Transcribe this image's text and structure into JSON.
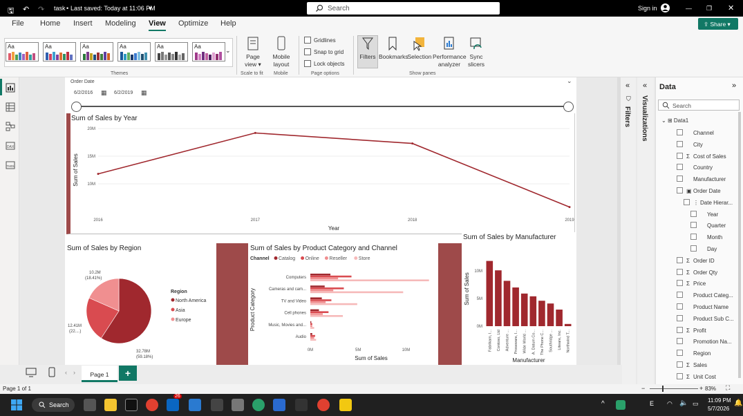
{
  "titlebar": {
    "file": "task",
    "saved": "Last saved: Today at 11:06 PM",
    "search": "Search",
    "signin": "Sign in",
    "share": "Share"
  },
  "menu": [
    "File",
    "Home",
    "Insert",
    "Modeling",
    "View",
    "Optimize",
    "Help"
  ],
  "ribbon": {
    "themes_label": "Themes",
    "page_view": "Page view",
    "scale_label": "Scale to fit",
    "mobile": "Mobile layout",
    "mobile_label": "Mobile",
    "gridlines": "Gridlines",
    "snap": "Snap to grid",
    "lock": "Lock objects",
    "page_options": "Page options",
    "filters": "Filters",
    "bookmarks": "Bookmarks",
    "selection": "Selection",
    "performance": "Performance analyzer",
    "sync": "Sync slicers",
    "show_panes": "Show panes",
    "theme_tag": "Aa"
  },
  "slicer": {
    "title": "Order Date",
    "start": "6/2/2016",
    "end": "6/2/2019"
  },
  "line_chart": {
    "title": "Sum of Sales by Year",
    "xlabel": "Year",
    "ylabel": "Sum of Sales",
    "x": [
      "2016",
      "2017",
      "2018",
      "2019"
    ],
    "y": [
      11.8,
      19.2,
      17.3,
      5.8
    ],
    "yticks": [
      "20M",
      "15M",
      "10M"
    ],
    "ylim": [
      5,
      20
    ]
  },
  "pie_chart": {
    "title": "Sum of Sales by Region",
    "legend_title": "Region",
    "legend": [
      "North America",
      "Asia",
      "Europe"
    ],
    "labels": {
      "na": "32.78M",
      "na_pct": "(59.18%)",
      "asia": "12.41M",
      "asia_pct": "(22....)",
      "eu": "10.2M",
      "eu_pct": "(18.41%)"
    }
  },
  "bar_chart": {
    "title": "Sum of Sales by Product Category and Channel",
    "legend_title": "Channel",
    "legend": [
      "Catalog",
      "Online",
      "Reseller",
      "Store"
    ],
    "ylabel": "Product Category",
    "xlabel": "Sum of Sales",
    "categories": [
      "Computers",
      "Cameras and cam...",
      "TV and Video",
      "Cell phones",
      "Music, Movies and...",
      "Audio"
    ],
    "xticks": [
      "0M",
      "5M",
      "10M"
    ]
  },
  "column_chart": {
    "title": "Sum of Sales by Manufacturer",
    "ylabel": "Sum of Sales",
    "xlabel": "Manufacturer",
    "yticks": [
      "10M",
      "5M",
      "0M"
    ],
    "categories": [
      "Fabrikam, I...",
      "Contoso, Ltd",
      "Adventure ...",
      "Proseware, I...",
      "Wide World ...",
      "A. Datum Co...",
      "The Phone C...",
      "Southridge ...",
      "Litware, Inc.",
      "Northwind T..."
    ]
  },
  "chart_data": [
    {
      "type": "line",
      "title": "Sum of Sales by Year",
      "xlabel": "Year",
      "ylabel": "Sum of Sales",
      "x": [
        "2016",
        "2017",
        "2018",
        "2019"
      ],
      "values": [
        11.8,
        19.2,
        17.3,
        5.8
      ],
      "ylim": [
        5,
        20
      ]
    },
    {
      "type": "pie",
      "title": "Sum of Sales by Region",
      "categories": [
        "North America",
        "Asia",
        "Europe"
      ],
      "values": [
        32.78,
        12.41,
        10.2
      ]
    },
    {
      "type": "bar",
      "title": "Sum of Sales by Product Category and Channel",
      "xlabel": "Sum of Sales",
      "ylabel": "Product Category",
      "categories": [
        "Computers",
        "Cameras and cam...",
        "TV and Video",
        "Cell phones",
        "Music, Movies and...",
        "Audio"
      ],
      "series": [
        {
          "name": "Catalog",
          "values": [
            2.1,
            1.5,
            1.2,
            0.9,
            0.1,
            0.2
          ]
        },
        {
          "name": "Online",
          "values": [
            4.3,
            3.5,
            2.2,
            1.9,
            0.2,
            0.5
          ]
        },
        {
          "name": "Reseller",
          "values": [
            2.9,
            2.4,
            1.6,
            1.3,
            0.2,
            0.4
          ]
        },
        {
          "name": "Store",
          "values": [
            12.4,
            9.7,
            4.9,
            3.4,
            0.4,
            0.6
          ]
        }
      ],
      "xlim": [
        0,
        13
      ]
    },
    {
      "type": "bar",
      "title": "Sum of Sales by Manufacturer",
      "xlabel": "Manufacturer",
      "ylabel": "Sum of Sales",
      "categories": [
        "Fabrikam, I...",
        "Contoso, Ltd",
        "Adventure ...",
        "Proseware, I...",
        "Wide World ...",
        "A. Datum Co...",
        "The Phone C...",
        "Southridge ...",
        "Litware, Inc.",
        "Northwind T..."
      ],
      "values": [
        11.8,
        10.1,
        8.2,
        7.0,
        5.9,
        5.4,
        4.6,
        4.1,
        3.0,
        0.4
      ],
      "ylim": [
        0,
        13
      ]
    }
  ],
  "panes": {
    "filters": "Filters",
    "visualizations": "Visualizations",
    "data": "Data",
    "search": "Search",
    "table": "Data1"
  },
  "fields": [
    [
      "Channel",
      ""
    ],
    [
      "City",
      ""
    ],
    [
      "Cost of Sales",
      "Σ"
    ],
    [
      "Country",
      ""
    ],
    [
      "Manufacturer",
      ""
    ],
    [
      "Order Date",
      "▣"
    ],
    [
      "Date Hierar...",
      "⋮"
    ],
    [
      "Year",
      ""
    ],
    [
      "Quarter",
      ""
    ],
    [
      "Month",
      ""
    ],
    [
      "Day",
      ""
    ],
    [
      "Order ID",
      "Σ"
    ],
    [
      "Order Qty",
      "Σ"
    ],
    [
      "Price",
      "Σ"
    ],
    [
      "Product Categ...",
      ""
    ],
    [
      "Product Name",
      ""
    ],
    [
      "Product Sub C...",
      ""
    ],
    [
      "Profit",
      "Σ"
    ],
    [
      "Promotion Na...",
      ""
    ],
    [
      "Region",
      ""
    ],
    [
      "Sales",
      "Σ"
    ],
    [
      "Unit Cost",
      "Σ"
    ]
  ],
  "bottom": {
    "page_tab": "Page 1",
    "status": "Page 1 of 1",
    "zoom": "83%"
  },
  "taskbar": {
    "search": "Search",
    "time": "11:09 PM",
    "date": "5/7/2026",
    "badge": "26"
  },
  "colors": {
    "dark_red": "#a0282e",
    "mid_red": "#d94b50",
    "light_red": "#f08f90",
    "pale_red": "#f6b9b9",
    "panel_bg": "#9e4a4a",
    "accent": "#117865"
  }
}
